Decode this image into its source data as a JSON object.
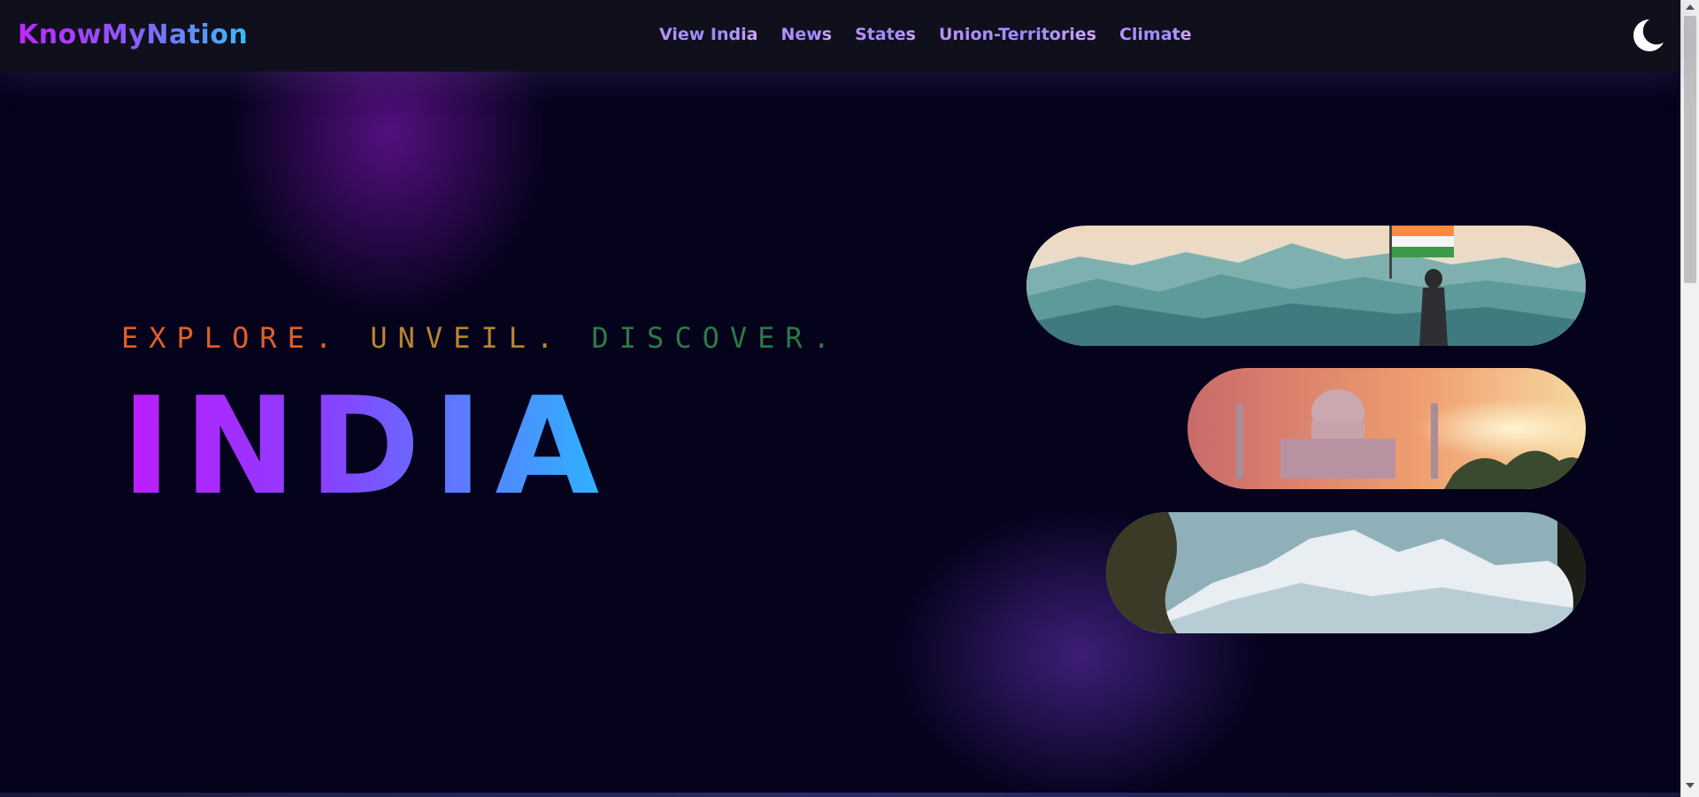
{
  "brand": {
    "name": "KnowMyNation"
  },
  "nav": {
    "items": [
      {
        "label": "View India"
      },
      {
        "label": "News"
      },
      {
        "label": "States"
      },
      {
        "label": "Union-Territories"
      },
      {
        "label": "Climate"
      }
    ]
  },
  "theme_toggle": {
    "icon": "moon-icon"
  },
  "hero": {
    "tagline": {
      "part1": "EXPLORE.",
      "part2": "UNVEIL.",
      "part3": "DISCOVER."
    },
    "title": "INDIA",
    "images": [
      {
        "icon": "mountain-flag-image"
      },
      {
        "icon": "taj-mahal-image"
      },
      {
        "icon": "snow-peaks-image"
      }
    ]
  },
  "colors": {
    "background": "#05021c",
    "navbar": "#100f1c",
    "tagline_orange": "#e0602a",
    "tagline_gold": "#b8862f",
    "tagline_green": "#2c7a46",
    "accent_purple": "#c01cff",
    "accent_blue": "#2ab7ff"
  }
}
